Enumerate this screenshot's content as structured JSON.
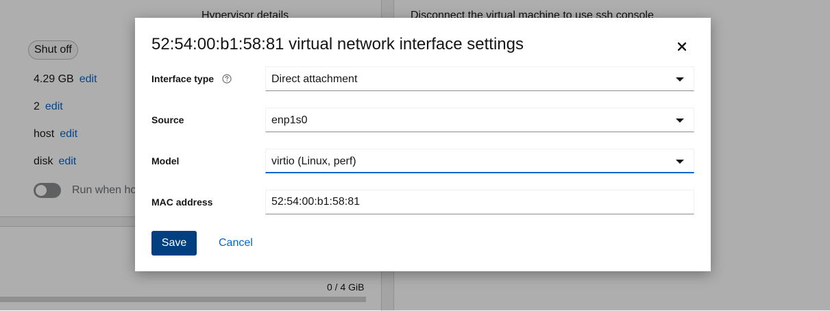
{
  "background": {
    "left_card": {
      "heading_clipped": "Hypervisor details",
      "state": "Shut off",
      "memory": {
        "value": "4.29 GB",
        "link": "edit"
      },
      "vcpus": {
        "value": "2",
        "link": "edit"
      },
      "cpu_type": {
        "value": "host",
        "link": "edit"
      },
      "boot_order": {
        "value": "disk",
        "link": "edit"
      },
      "autostart": {
        "label": "Run when ho",
        "on": false
      }
    },
    "right_card": {
      "text_clipped": "Disconnect the virtual machine to use ssh console"
    },
    "bottom_card": {
      "usage": "0 / 4 GiB",
      "usage_fraction": 0
    }
  },
  "modal": {
    "title": "52:54:00:b1:58:81 virtual network interface settings",
    "close_icon": "close-icon",
    "fields": {
      "interface_type": {
        "label": "Interface type",
        "value": "Direct attachment",
        "help_icon": "help-icon"
      },
      "source": {
        "label": "Source",
        "value": "enp1s0"
      },
      "model": {
        "label": "Model",
        "value": "virtio (Linux, perf)"
      },
      "mac_address": {
        "label": "MAC address",
        "value": "52:54:00:b1:58:81"
      }
    },
    "buttons": {
      "save": "Save",
      "cancel": "Cancel"
    }
  },
  "colors": {
    "primary": "#004080",
    "link": "#0066cc",
    "focus": "#0066cc",
    "backdrop": "rgba(3,3,3,0.32)"
  }
}
